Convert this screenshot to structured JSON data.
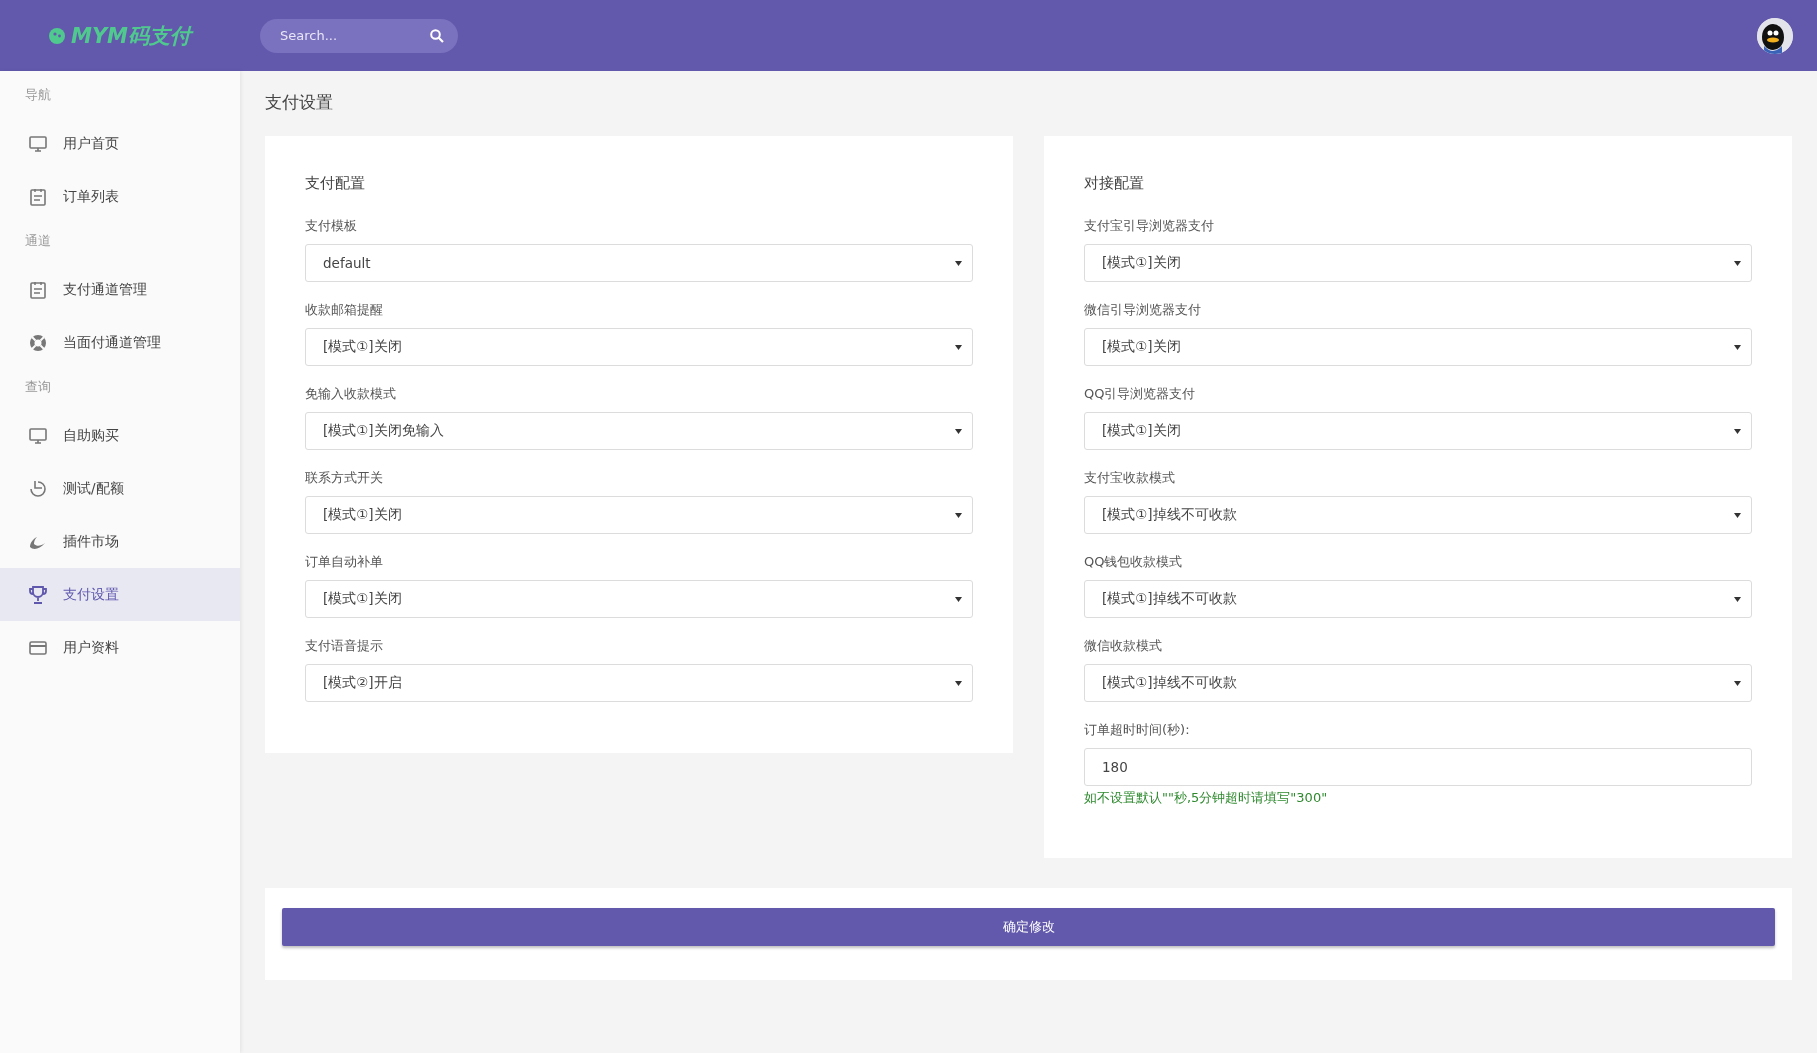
{
  "topbar": {
    "logo": "MYM码支付",
    "search": {
      "placeholder": "Search..."
    }
  },
  "sidebar": {
    "sections": [
      {
        "header": "导航",
        "items": [
          {
            "label": "用户首页",
            "selected": false
          },
          {
            "label": "订单列表",
            "selected": false
          }
        ]
      },
      {
        "header": "通道",
        "items": [
          {
            "label": "支付通道管理",
            "selected": false
          },
          {
            "label": "当面付通道管理",
            "selected": false
          }
        ]
      },
      {
        "header": "查询",
        "items": [
          {
            "label": "自助购买",
            "selected": false
          },
          {
            "label": "测试/配额",
            "selected": false
          },
          {
            "label": "插件市场",
            "selected": false
          },
          {
            "label": "支付设置",
            "selected": true
          },
          {
            "label": "用户资料",
            "selected": false
          }
        ]
      }
    ]
  },
  "page_title": "支付设置",
  "cards": [
    {
      "title": "支付配置",
      "fields": [
        {
          "kind": "select",
          "label": "支付模板",
          "value": "default"
        },
        {
          "kind": "select",
          "label": "收款邮箱提醒",
          "value": "[模式①]关闭"
        },
        {
          "kind": "select",
          "label": "免输入收款模式",
          "value": "[模式①]关闭免输入"
        },
        {
          "kind": "select",
          "label": "联系方式开关",
          "value": "[模式①]关闭"
        },
        {
          "kind": "select",
          "label": "订单自动补单",
          "value": "[模式①]关闭"
        },
        {
          "kind": "select",
          "label": "支付语音提示",
          "value": "[模式②]开启"
        }
      ]
    },
    {
      "title": "对接配置",
      "fields": [
        {
          "kind": "select",
          "label": "支付宝引导浏览器支付",
          "value": "[模式①]关闭"
        },
        {
          "kind": "select",
          "label": "微信引导浏览器支付",
          "value": "[模式①]关闭"
        },
        {
          "kind": "select",
          "label": "QQ引导浏览器支付",
          "value": "[模式①]关闭"
        },
        {
          "kind": "select",
          "label": "支付宝收款模式",
          "value": "[模式①]掉线不可收款"
        },
        {
          "kind": "select",
          "label": "QQ钱包收款模式",
          "value": "[模式①]掉线不可收款"
        },
        {
          "kind": "select",
          "label": "微信收款模式",
          "value": "[模式①]掉线不可收款"
        },
        {
          "kind": "input",
          "label": "订单超时时间(秒):",
          "value": "180",
          "hint": "如不设置默认\"\"秒,5分钟超时请填写\"300\""
        }
      ]
    }
  ],
  "submit_button": "确定修改"
}
